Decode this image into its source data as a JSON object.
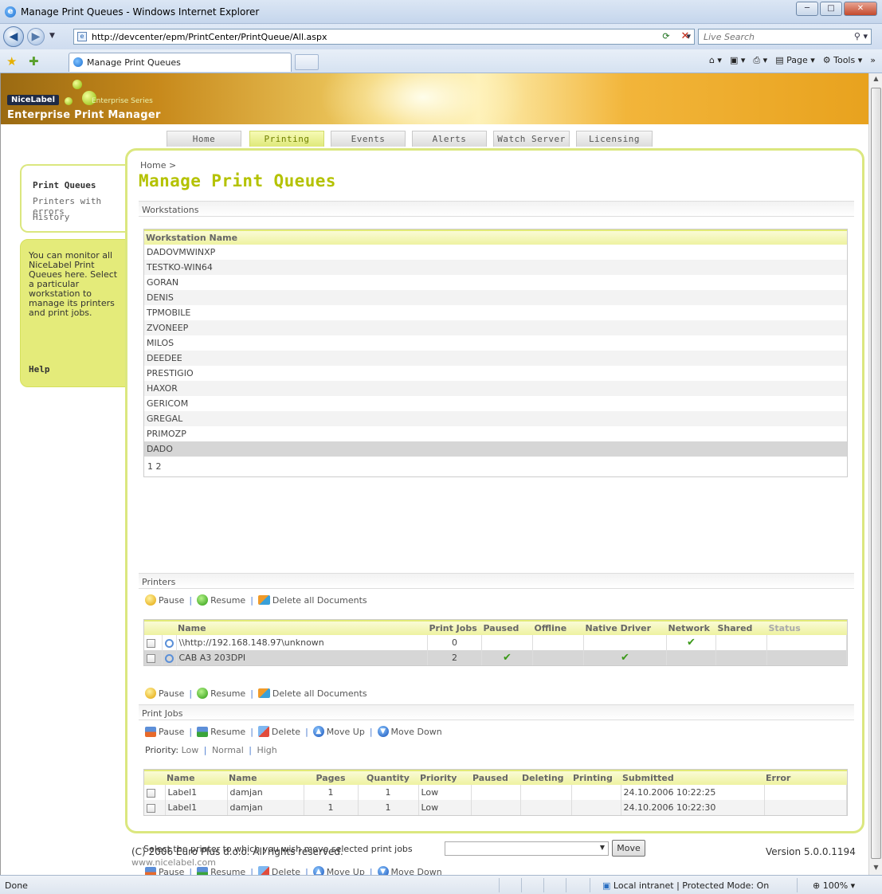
{
  "window": {
    "title": "Manage Print Queues - Windows Internet Explorer",
    "url": "http://devcenter/epm/PrintCenter/PrintQueue/All.aspx",
    "search_placeholder": "Live Search",
    "tab_label": "Manage Print Queues",
    "cmd_page": "Page",
    "cmd_tools": "Tools",
    "status_left": "Done",
    "status_zone": "Local intranet | Protected Mode: On",
    "status_zoom": "100%"
  },
  "banner": {
    "logo": "NiceLabel",
    "series": "Enterprise Series",
    "product": "Enterprise Print Manager"
  },
  "nav": {
    "tabs": [
      "Home",
      "Printing",
      "Events",
      "Alerts",
      "Watch Server",
      "Licensing"
    ],
    "active": "Printing"
  },
  "sidebar": {
    "items": [
      "Print Queues",
      "Printers with errors",
      "History"
    ],
    "help_text": "You can monitor all NiceLabel Print Queues here. Select a particular workstation to manage its printers and print jobs.",
    "help_link": "Help"
  },
  "page": {
    "breadcrumb": "Home >",
    "title": "Manage Print Queues"
  },
  "workstations": {
    "section": "Workstations",
    "header": "Workstation Name",
    "rows": [
      "DADOVMWINXP",
      "TESTKO-WIN64",
      "GORAN",
      "DENIS",
      "TPMOBILE",
      "ZVONEEP",
      "MILOS",
      "DEEDEE",
      "PRESTIGIO",
      "HAXOR",
      "GERICOM",
      "GREGAL",
      "PRIMOZP",
      "DADO"
    ],
    "selected": "DADO",
    "pager": "1 2"
  },
  "printers": {
    "section": "Printers",
    "actions": [
      "Pause",
      "Resume",
      "Delete all Documents"
    ],
    "columns": [
      "Name",
      "Print Jobs",
      "Paused",
      "Offline",
      "Native Driver",
      "Network",
      "Shared",
      "Status"
    ],
    "rows": [
      {
        "name": "\\\\http://192.168.148.97\\unknown",
        "jobs": "0",
        "paused": false,
        "offline": false,
        "native": false,
        "network": true,
        "shared": false,
        "status": ""
      },
      {
        "name": "CAB A3 203DPI",
        "jobs": "2",
        "paused": true,
        "offline": false,
        "native": true,
        "network": false,
        "shared": false,
        "status": ""
      }
    ]
  },
  "printjobs": {
    "section": "Print Jobs",
    "actions": [
      "Pause",
      "Resume",
      "Delete",
      "Move Up",
      "Move Down"
    ],
    "priority_label": "Priority:",
    "priority_options": [
      "Low",
      "Normal",
      "High"
    ],
    "columns": [
      "Name",
      "Name",
      "Pages",
      "Quantity",
      "Priority",
      "Paused",
      "Deleting",
      "Printing",
      "Submitted",
      "Error"
    ],
    "rows": [
      {
        "doc": "Label1",
        "user": "damjan",
        "pages": "1",
        "quantity": "1",
        "priority": "Low",
        "submitted": "24.10.2006 10:22:25"
      },
      {
        "doc": "Label1",
        "user": "damjan",
        "pages": "1",
        "quantity": "1",
        "priority": "Low",
        "submitted": "24.10.2006 10:22:30"
      }
    ],
    "move_label": "Select the printer to which you wish move selected print jobs",
    "move_button": "Move"
  },
  "footer": {
    "copyright": "(C) 2006 Euro Plus d.o.o. All rights reserved.",
    "site": "www.nicelabel.com",
    "version": "Version 5.0.0.1194"
  }
}
